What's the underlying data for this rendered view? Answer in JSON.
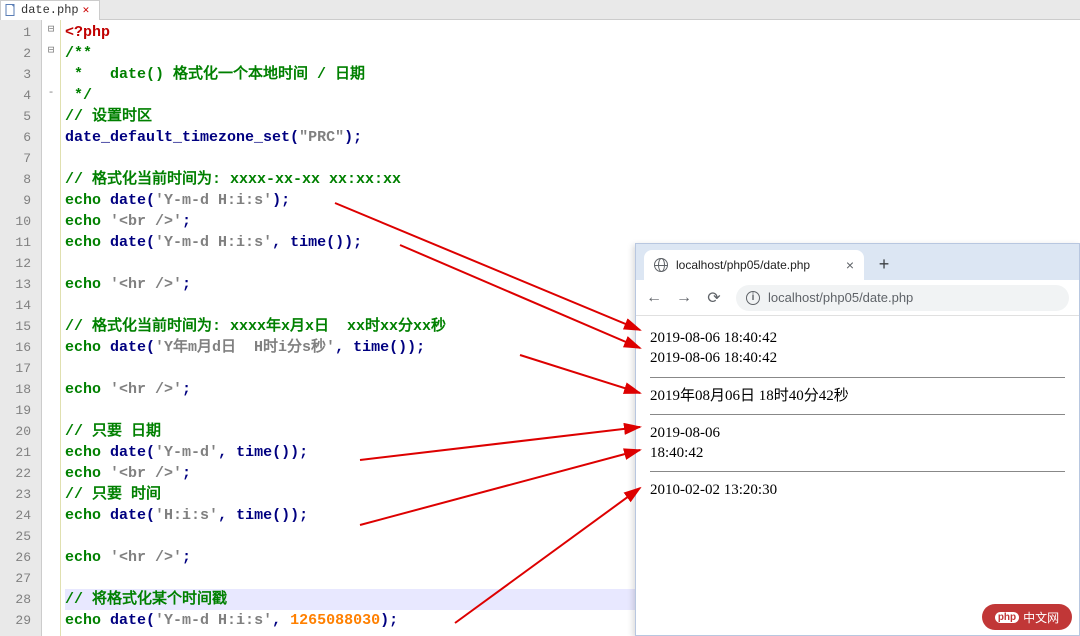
{
  "editor": {
    "tab": {
      "filename": "date.php",
      "closeGlyph": "✕"
    },
    "fold": {
      "1": "⊟",
      "2": "⊟",
      "4": "-"
    },
    "lines": [
      {
        "n": 1,
        "tokens": [
          {
            "t": "<?php",
            "c": "php"
          }
        ]
      },
      {
        "n": 2,
        "tokens": [
          {
            "t": "/**",
            "c": "cmt"
          }
        ]
      },
      {
        "n": 3,
        "tokens": [
          {
            "t": " *   date() 格式化一个本地时间 / 日期",
            "c": "cmt"
          }
        ]
      },
      {
        "n": 4,
        "tokens": [
          {
            "t": " */",
            "c": "cmt"
          }
        ]
      },
      {
        "n": 5,
        "tokens": [
          {
            "t": "// 设置时区",
            "c": "cmt"
          }
        ]
      },
      {
        "n": 6,
        "tokens": [
          {
            "t": "date_default_timezone_set",
            "c": "func"
          },
          {
            "t": "(",
            "c": "pn"
          },
          {
            "t": "\"PRC\"",
            "c": "str"
          },
          {
            "t": ");",
            "c": "pn"
          }
        ]
      },
      {
        "n": 7,
        "tokens": []
      },
      {
        "n": 8,
        "tokens": [
          {
            "t": "// 格式化当前时间为: xxxx-xx-xx xx:xx:xx",
            "c": "cmt"
          }
        ]
      },
      {
        "n": 9,
        "tokens": [
          {
            "t": "echo ",
            "c": "kw"
          },
          {
            "t": "date",
            "c": "func"
          },
          {
            "t": "(",
            "c": "pn"
          },
          {
            "t": "'Y-m-d H:i:s'",
            "c": "str"
          },
          {
            "t": ");",
            "c": "pn"
          }
        ]
      },
      {
        "n": 10,
        "tokens": [
          {
            "t": "echo ",
            "c": "kw"
          },
          {
            "t": "'<br />'",
            "c": "str"
          },
          {
            "t": ";",
            "c": "pn"
          }
        ]
      },
      {
        "n": 11,
        "tokens": [
          {
            "t": "echo ",
            "c": "kw"
          },
          {
            "t": "date",
            "c": "func"
          },
          {
            "t": "(",
            "c": "pn"
          },
          {
            "t": "'Y-m-d H:i:s'",
            "c": "str"
          },
          {
            "t": ", ",
            "c": "pn"
          },
          {
            "t": "time",
            "c": "func"
          },
          {
            "t": "());",
            "c": "pn"
          }
        ]
      },
      {
        "n": 12,
        "tokens": []
      },
      {
        "n": 13,
        "tokens": [
          {
            "t": "echo ",
            "c": "kw"
          },
          {
            "t": "'<hr />'",
            "c": "str"
          },
          {
            "t": ";",
            "c": "pn"
          }
        ]
      },
      {
        "n": 14,
        "tokens": []
      },
      {
        "n": 15,
        "tokens": [
          {
            "t": "// 格式化当前时间为: xxxx年x月x日  xx时xx分xx秒",
            "c": "cmt"
          }
        ]
      },
      {
        "n": 16,
        "tokens": [
          {
            "t": "echo ",
            "c": "kw"
          },
          {
            "t": "date",
            "c": "func"
          },
          {
            "t": "(",
            "c": "pn"
          },
          {
            "t": "'Y年m月d日  H时i分s秒'",
            "c": "str"
          },
          {
            "t": ", ",
            "c": "pn"
          },
          {
            "t": "time",
            "c": "func"
          },
          {
            "t": "());",
            "c": "pn"
          }
        ]
      },
      {
        "n": 17,
        "tokens": []
      },
      {
        "n": 18,
        "tokens": [
          {
            "t": "echo ",
            "c": "kw"
          },
          {
            "t": "'<hr />'",
            "c": "str"
          },
          {
            "t": ";",
            "c": "pn"
          }
        ]
      },
      {
        "n": 19,
        "tokens": []
      },
      {
        "n": 20,
        "tokens": [
          {
            "t": "// 只要 日期",
            "c": "cmt"
          }
        ]
      },
      {
        "n": 21,
        "tokens": [
          {
            "t": "echo ",
            "c": "kw"
          },
          {
            "t": "date",
            "c": "func"
          },
          {
            "t": "(",
            "c": "pn"
          },
          {
            "t": "'Y-m-d'",
            "c": "str"
          },
          {
            "t": ", ",
            "c": "pn"
          },
          {
            "t": "time",
            "c": "func"
          },
          {
            "t": "());",
            "c": "pn"
          }
        ]
      },
      {
        "n": 22,
        "tokens": [
          {
            "t": "echo ",
            "c": "kw"
          },
          {
            "t": "'<br />'",
            "c": "str"
          },
          {
            "t": ";",
            "c": "pn"
          }
        ]
      },
      {
        "n": 23,
        "tokens": [
          {
            "t": "// 只要 时间",
            "c": "cmt"
          }
        ]
      },
      {
        "n": 24,
        "tokens": [
          {
            "t": "echo ",
            "c": "kw"
          },
          {
            "t": "date",
            "c": "func"
          },
          {
            "t": "(",
            "c": "pn"
          },
          {
            "t": "'H:i:s'",
            "c": "str"
          },
          {
            "t": ", ",
            "c": "pn"
          },
          {
            "t": "time",
            "c": "func"
          },
          {
            "t": "());",
            "c": "pn"
          }
        ]
      },
      {
        "n": 25,
        "tokens": []
      },
      {
        "n": 26,
        "tokens": [
          {
            "t": "echo ",
            "c": "kw"
          },
          {
            "t": "'<hr />'",
            "c": "str"
          },
          {
            "t": ";",
            "c": "pn"
          }
        ]
      },
      {
        "n": 27,
        "tokens": []
      },
      {
        "n": 28,
        "hl": true,
        "tokens": [
          {
            "t": "// 将格式化某个时间戳",
            "c": "cmt"
          }
        ]
      },
      {
        "n": 29,
        "tokens": [
          {
            "t": "echo ",
            "c": "kw"
          },
          {
            "t": "date",
            "c": "func"
          },
          {
            "t": "(",
            "c": "pn"
          },
          {
            "t": "'Y-m-d H:i:s'",
            "c": "str"
          },
          {
            "t": ", ",
            "c": "pn"
          },
          {
            "t": "1265088030",
            "c": "num"
          },
          {
            "t": ");",
            "c": "pn"
          }
        ]
      }
    ]
  },
  "browser": {
    "tabTitle": "localhost/php05/date.php",
    "closeGlyph": "×",
    "plusGlyph": "+",
    "nav": {
      "back": "←",
      "forward": "→",
      "reload": "⟳"
    },
    "url": "localhost/php05/date.php",
    "output": {
      "block1": [
        "2019-08-06 18:40:42",
        "2019-08-06 18:40:42"
      ],
      "block2": [
        "2019年08月06日 18时40分42秒"
      ],
      "block3": [
        "2019-08-06",
        "18:40:42"
      ],
      "block4": [
        "2010-02-02 13:20:30"
      ]
    }
  },
  "watermark": {
    "logo": "php",
    "text": "中文网"
  }
}
